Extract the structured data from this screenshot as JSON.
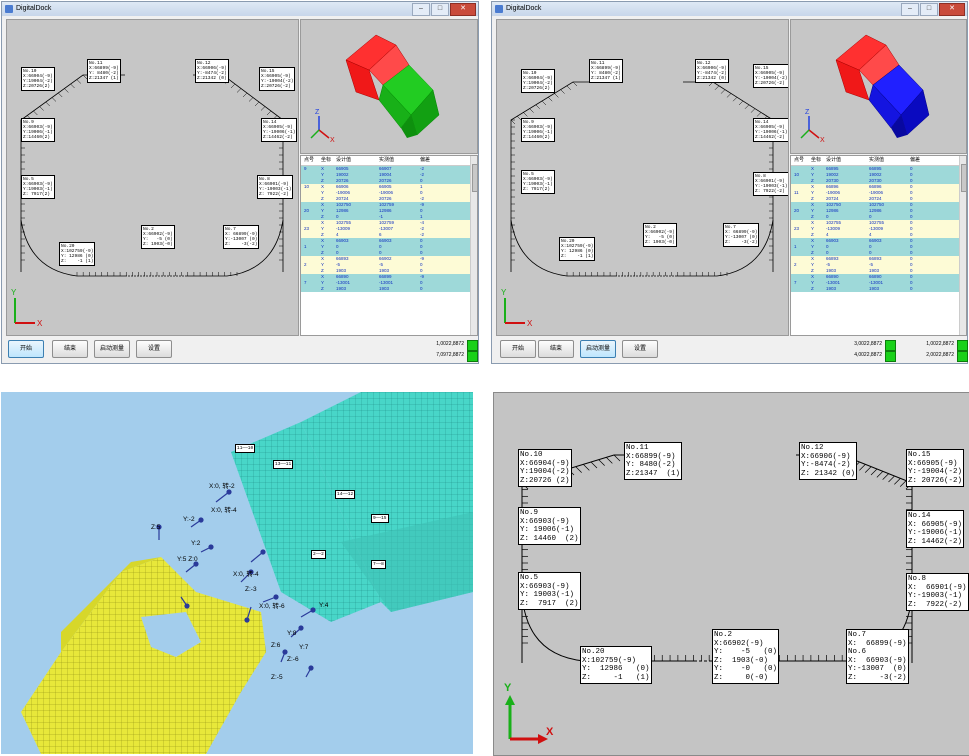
{
  "panel1": {
    "window_title": "DigitalDock",
    "annotations": [
      {
        "label": "No.11\nX:66899(-9)\nY: 8480(-2)\nZ:21347 (1)"
      },
      {
        "label": "No.12\nX:66906(-9)\nY:-8474(-2)\nZ:21342 (0)"
      },
      {
        "label": "No.10\nX:66904(-9)\nY:19004(-2)\nZ:20726(2)"
      },
      {
        "label": "No.15\nX:66905(-9)\nY:-19004(-2)\nZ:20726(-2)"
      },
      {
        "label": "No.9\nX:66903(-9)\nY:19006(-1)\nZ:14460(2)"
      },
      {
        "label": "No.14\nX:66905(-9)\nY:-19006(-1)\nZ:14462(-2)"
      },
      {
        "label": "No.5\nX:66903(-9)\nY:19003(-1)\nZ: 7917(2)"
      },
      {
        "label": "No.8\nX:66901(-9)\nY:-19003(-1)\nZ: 7922(-2)"
      },
      {
        "label": "No.20\nX:102759(-9)\nY: 12986 (0)\nZ:    -1 (1)"
      },
      {
        "label": "No.2\nX:66902(-9)\nY:   -5 (0)\nZ: 1903(-0)"
      },
      {
        "label": "No.7\nX: 66899(-9)\nY:-13007 (0)\nZ:    -3(-2)"
      }
    ],
    "table_headers": [
      "点号",
      "坐标",
      "设计值",
      "实测值",
      "偏差"
    ],
    "table_rows": [
      [
        "9",
        "X",
        "66905",
        "66907",
        "-2"
      ],
      [
        "",
        "Y",
        "19002",
        "19004",
        "-2"
      ],
      [
        "",
        "Z",
        "20726",
        "20726",
        "0"
      ],
      [
        "10",
        "X",
        "66906",
        "66905",
        "1"
      ],
      [
        "",
        "Y",
        "-19006",
        "-19006",
        "0"
      ],
      [
        "",
        "Z",
        "20724",
        "20726",
        "-2"
      ],
      [
        "",
        "X",
        "102750",
        "102759",
        "-9"
      ],
      [
        "20",
        "Y",
        "12986",
        "12986",
        "0"
      ],
      [
        "",
        "Z",
        "0",
        "-1",
        "1"
      ],
      [
        "",
        "X",
        "102755",
        "102759",
        "-4"
      ],
      [
        "23",
        "Y",
        "-13009",
        "-13007",
        "-2"
      ],
      [
        "",
        "Z",
        "4",
        "6",
        "-2"
      ],
      [
        "",
        "X",
        "66903",
        "66903",
        "0"
      ],
      [
        "1",
        "Y",
        "0",
        "0",
        "0"
      ],
      [
        "",
        "Z",
        "0",
        "0",
        "0"
      ],
      [
        "",
        "X",
        "66893",
        "66902",
        "-9"
      ],
      [
        "2",
        "Y",
        "-5",
        "-5",
        "0"
      ],
      [
        "",
        "Z",
        "1903",
        "1903",
        "0"
      ],
      [
        "",
        "X",
        "66890",
        "66899",
        "-9"
      ],
      [
        "7",
        "Y",
        "-13001",
        "-13001",
        "0"
      ],
      [
        "",
        "Z",
        "1903",
        "1903",
        "0"
      ]
    ],
    "buttons": [
      "开始",
      "结束",
      "启动测量",
      "设置"
    ],
    "status": [
      "1,0022,8872",
      "7,0972,8872"
    ]
  },
  "panel2": {
    "window_title": "DigitalDock",
    "annotations": [
      {
        "label": "No.10\nX:66904(-9)\nY:19004(-2)\nZ:20726(2)"
      },
      {
        "label": "No.11\nX:66899(-9)\nY: 8480(-2)\nZ:21347 (1)"
      },
      {
        "label": "No.12\nX:66906(-9)\nY:-8474(-2)\nZ:21342 (0)"
      },
      {
        "label": "No.15\nX:66905(-9)\nY:-19004(-2)\nZ:20726(-2)"
      },
      {
        "label": "No.9\nX:66903(-9)\nY:19006(-1)\nZ:14460(2)"
      },
      {
        "label": "No.14\nX:66905(-9)\nY:-19006(-1)\nZ:14462(-2)"
      },
      {
        "label": "No.5\nX:66903(-9)\nY:19003(-1)\nZ: 7917(2)"
      },
      {
        "label": "No.8\nX:66901(-9)\nY:-19003(-1)\nZ: 7922(-2)"
      },
      {
        "label": "No.20\nX:102759(-9)\nY: 12986 (0)\nZ:    -1 (1)"
      },
      {
        "label": "No.2\nX:66902(-9)\nY:   -5 (0)\nZ: 1903(-0)"
      },
      {
        "label": "No.7\nX: 66899(-9)\nY:-13007 (0)\nZ:    -3(-2)"
      }
    ],
    "table_headers": [
      "点号",
      "坐标",
      "设计值",
      "实测值",
      "偏差"
    ],
    "table_rows": [
      [
        "",
        "X",
        "66895",
        "66895",
        "0"
      ],
      [
        "10",
        "Y",
        "19002",
        "19002",
        "0"
      ],
      [
        "",
        "Z",
        "20730",
        "20730",
        "0"
      ],
      [
        "",
        "X",
        "66896",
        "66896",
        "0"
      ],
      [
        "11",
        "Y",
        "-19006",
        "-19006",
        "0"
      ],
      [
        "",
        "Z",
        "20724",
        "20724",
        "0"
      ],
      [
        "",
        "X",
        "102750",
        "102750",
        "0"
      ],
      [
        "20",
        "Y",
        "12986",
        "12986",
        "0"
      ],
      [
        "",
        "Z",
        "0",
        "0",
        "0"
      ],
      [
        "",
        "X",
        "102755",
        "102755",
        "0"
      ],
      [
        "23",
        "Y",
        "-13009",
        "-13009",
        "0"
      ],
      [
        "",
        "Z",
        "4",
        "4",
        "0"
      ],
      [
        "",
        "X",
        "66903",
        "66903",
        "0"
      ],
      [
        "1",
        "Y",
        "0",
        "0",
        "0"
      ],
      [
        "",
        "Z",
        "0",
        "0",
        "0"
      ],
      [
        "",
        "X",
        "66893",
        "66893",
        "0"
      ],
      [
        "2",
        "Y",
        "-5",
        "-5",
        "0"
      ],
      [
        "",
        "Z",
        "1903",
        "1903",
        "0"
      ],
      [
        "",
        "X",
        "66890",
        "66890",
        "0"
      ],
      [
        "7",
        "Y",
        "-13001",
        "-13001",
        "0"
      ],
      [
        "",
        "Z",
        "1903",
        "1903",
        "0"
      ]
    ],
    "buttons": [
      "开始",
      "结束",
      "启动测量",
      "设置"
    ],
    "status": [
      "3,0022,8872",
      "4,0022,8872",
      "1,0022,8872",
      "2,0022,8872"
    ]
  },
  "panel3": {
    "labels": [
      {
        "text": "11——10"
      },
      {
        "text": "13——11"
      },
      {
        "text": "14——12"
      },
      {
        "text": "9——15"
      },
      {
        "text": "2——2"
      },
      {
        "text": "7——8"
      },
      {
        "text": "X:0, 转-2"
      },
      {
        "text": "Y:-2"
      },
      {
        "text": "X:0, 转-4"
      },
      {
        "text": "Z:5"
      },
      {
        "text": "Y:2"
      },
      {
        "text": "Y:5 Z:0"
      },
      {
        "text": "X:0, 转-4"
      },
      {
        "text": "Z:-3"
      },
      {
        "text": "X:0, 转-6"
      },
      {
        "text": "Y:4"
      },
      {
        "text": "Y:8"
      },
      {
        "text": "Y:7"
      },
      {
        "text": "Z:6"
      },
      {
        "text": "Z:-6"
      },
      {
        "text": "Z:-5"
      }
    ]
  },
  "panel4": {
    "annotations": [
      {
        "label": "No.10\nX:66904(-9)\nY:19004(-2)\nZ:20726 (2)"
      },
      {
        "label": "No.11\nX:66899(-9)\nY: 8480(-2)\nZ:21347  (1)"
      },
      {
        "label": "No.12\nX:66906(-9)\nY:-8474(-2)\nZ: 21342 (0)"
      },
      {
        "label": "No.15\nX:66905(-9)\nY:-19004(-2)\nZ: 20726(-2)"
      },
      {
        "label": "No.9\nX:66903(-9)\nY: 19006(-1)\nZ: 14460  (2)"
      },
      {
        "label": "No.14\nX: 66905(-9)\nY:-19006(-1)\nZ: 14462(-2)"
      },
      {
        "label": "No.5\nX:66903(-9)\nY: 19003(-1)\nZ:  7917  (2)"
      },
      {
        "label": "No.8\nX:  66901(-9)\nY:-19003(-1)\nZ:  7922(-2)"
      },
      {
        "label": "No.20\nX:102759(-9)\nY:  12986   (0)\nZ:     -1   (1)"
      },
      {
        "label": "No.2\nX:66902(-9)\nY:    -5   (0)\nZ:  1903(-0)\nY:    -0   (0)\nZ:     0(-0)"
      },
      {
        "label": "No.7\nX:  66899(-9)\nNo.6\nX:  66903(-9)\nY:-13007  (0)\nZ:     -3(-2)"
      }
    ]
  },
  "colors": {
    "view_bg": "#c6c6c6",
    "table_cyan": "#9ed9d9",
    "table_yellow": "#fdfbd6",
    "mesh_green": "#48d6c8",
    "mesh_yellow": "#e8e83a",
    "photo_bg": "#a3cdec",
    "led": "#19d119"
  }
}
